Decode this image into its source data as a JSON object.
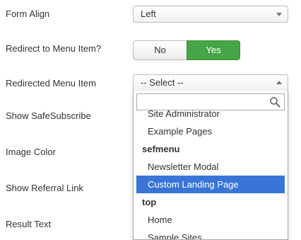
{
  "form_align": {
    "label": "Form Align",
    "value": "Left"
  },
  "redirect": {
    "label": "Redirect to Menu Item?",
    "no_label": "No",
    "yes_label": "Yes"
  },
  "redirected_menu_item": {
    "label": "Redirected Menu Item",
    "value": "-- Select --",
    "search_placeholder": "",
    "options": [
      {
        "label": "Site Administrator",
        "type": "option"
      },
      {
        "label": "Example Pages",
        "type": "option"
      },
      {
        "label": "sefmenu",
        "type": "group"
      },
      {
        "label": "Newsletter Modal",
        "type": "option"
      },
      {
        "label": "Custom Landing Page",
        "type": "option",
        "highlighted": true
      },
      {
        "label": "top",
        "type": "group"
      },
      {
        "label": "Home",
        "type": "option"
      },
      {
        "label": "Sample Sites",
        "type": "option"
      }
    ]
  },
  "show_safesubscribe": {
    "label": "Show SafeSubscribe"
  },
  "image_color": {
    "label": "Image Color"
  },
  "show_referral_link": {
    "label": "Show Referral Link"
  },
  "result_text": {
    "label": "Result Text"
  },
  "colors": {
    "yes_active": "#46a546",
    "highlight": "#3875d7"
  }
}
